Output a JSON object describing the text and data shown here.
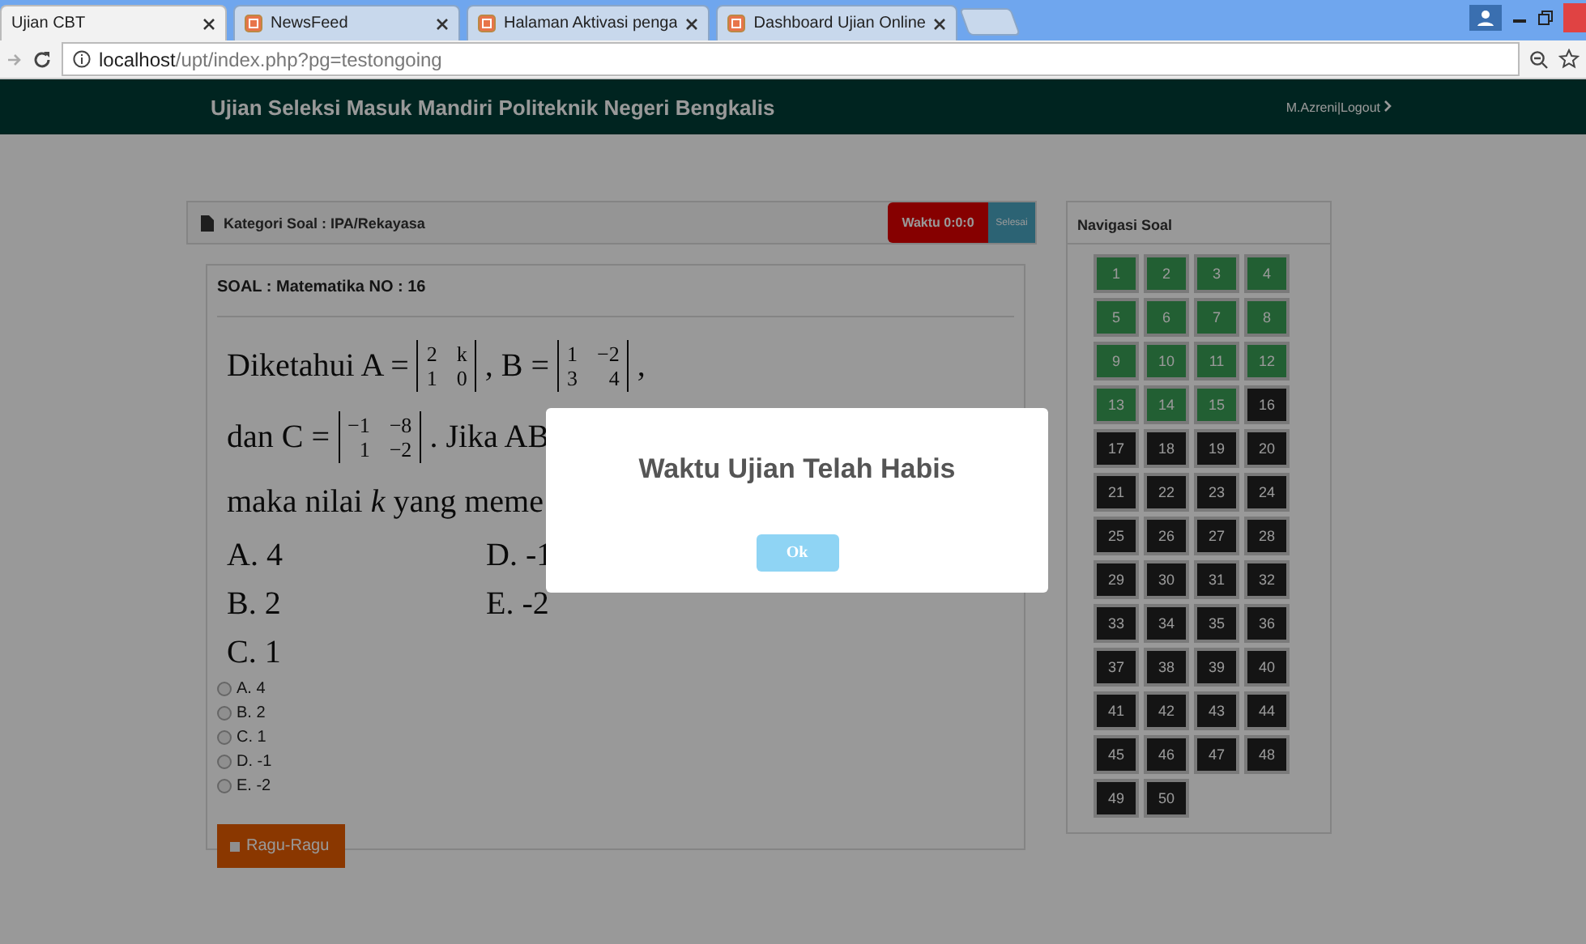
{
  "browser": {
    "tabs": [
      {
        "title": "Ujian CBT",
        "selected": true
      },
      {
        "title": "NewsFeed",
        "selected": false
      },
      {
        "title": "Halaman Aktivasi penga",
        "selected": false
      },
      {
        "title": "Dashboard Ujian Online",
        "selected": false
      }
    ],
    "address": {
      "host": "localhost",
      "path": "/upt/index.php?pg=testongoing"
    }
  },
  "header": {
    "title": "Ujian Seleksi Masuk Mandiri Politeknik Negeri Bengkalis",
    "user": "M.Azreni|Logout"
  },
  "exam": {
    "category": "Kategori Soal : IPA/Rekayasa",
    "timer": "Waktu 0:0:0",
    "finish": "Selesai",
    "question_label": "SOAL : Matematika NO : 16",
    "statement": {
      "intro": "Diketahui A =",
      "matrix_a": [
        [
          "2",
          "k"
        ],
        [
          "1",
          "0"
        ]
      ],
      "mid": ", B =",
      "matrix_b": [
        [
          "1",
          "−2"
        ],
        [
          "3",
          "4"
        ]
      ],
      "end": ",",
      "line2_start": "dan C =",
      "matrix_c": [
        [
          "−1",
          "−8"
        ],
        [
          "1",
          "−2"
        ]
      ],
      "line2_end": ". Jika AB",
      "line3": "maka nilai *k* yang meme",
      "choices": [
        [
          "A. 4",
          "D. -1"
        ],
        [
          "B. 2",
          "E. -2"
        ],
        [
          "C. 1"
        ]
      ]
    },
    "options": [
      {
        "label": "A. 4",
        "selected": false
      },
      {
        "label": "B. 2",
        "selected": false
      },
      {
        "label": "C. 1",
        "selected": false
      },
      {
        "label": "D. -1",
        "selected": false
      },
      {
        "label": "E. -2",
        "selected": false
      }
    ],
    "doubt": {
      "label": "Ragu-Ragu",
      "checked": false
    }
  },
  "navigation": {
    "title": "Navigasi Soal",
    "items": [
      {
        "n": "1",
        "answered": true
      },
      {
        "n": "2",
        "answered": true
      },
      {
        "n": "3",
        "answered": true
      },
      {
        "n": "4",
        "answered": true
      },
      {
        "n": "5",
        "answered": true
      },
      {
        "n": "6",
        "answered": true
      },
      {
        "n": "7",
        "answered": true
      },
      {
        "n": "8",
        "answered": true
      },
      {
        "n": "9",
        "answered": true
      },
      {
        "n": "10",
        "answered": true
      },
      {
        "n": "11",
        "answered": true
      },
      {
        "n": "12",
        "answered": true
      },
      {
        "n": "13",
        "answered": true
      },
      {
        "n": "14",
        "answered": true
      },
      {
        "n": "15",
        "answered": true
      },
      {
        "n": "16",
        "answered": false
      },
      {
        "n": "17",
        "answered": false
      },
      {
        "n": "18",
        "answered": false
      },
      {
        "n": "19",
        "answered": false
      },
      {
        "n": "20",
        "answered": false
      },
      {
        "n": "21",
        "answered": false
      },
      {
        "n": "22",
        "answered": false
      },
      {
        "n": "23",
        "answered": false
      },
      {
        "n": "24",
        "answered": false
      },
      {
        "n": "25",
        "answered": false
      },
      {
        "n": "26",
        "answered": false
      },
      {
        "n": "27",
        "answered": false
      },
      {
        "n": "28",
        "answered": false
      },
      {
        "n": "29",
        "answered": false
      },
      {
        "n": "30",
        "answered": false
      },
      {
        "n": "31",
        "answered": false
      },
      {
        "n": "32",
        "answered": false
      },
      {
        "n": "33",
        "answered": false
      },
      {
        "n": "34",
        "answered": false
      },
      {
        "n": "35",
        "answered": false
      },
      {
        "n": "36",
        "answered": false
      },
      {
        "n": "37",
        "answered": false
      },
      {
        "n": "38",
        "answered": false
      },
      {
        "n": "39",
        "answered": false
      },
      {
        "n": "40",
        "answered": false
      },
      {
        "n": "41",
        "answered": false
      },
      {
        "n": "42",
        "answered": false
      },
      {
        "n": "43",
        "answered": false
      },
      {
        "n": "44",
        "answered": false
      },
      {
        "n": "45",
        "answered": false
      },
      {
        "n": "46",
        "answered": false
      },
      {
        "n": "47",
        "answered": false
      },
      {
        "n": "48",
        "answered": false
      },
      {
        "n": "49",
        "answered": false
      },
      {
        "n": "50",
        "answered": false
      }
    ]
  },
  "dialog": {
    "message": "Waktu Ujian Telah Habis",
    "button": "Ok"
  }
}
